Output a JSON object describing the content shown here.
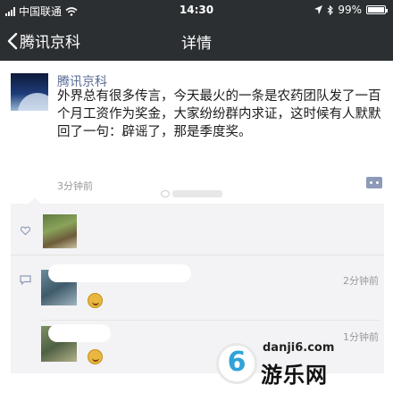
{
  "status_bar": {
    "carrier": "中国联通",
    "time": "14:30",
    "battery": "99%",
    "battery_level": 0.99
  },
  "nav": {
    "back_label": "腾讯京科",
    "title": "详情"
  },
  "post": {
    "author": "腾讯京科",
    "content": "外界总有很多传言，今天最火的一条是农药团队发了一百个月工资作为奖金，大家纷纷群内求证，这时候有人默默回了一句：辟谣了，那是季度奖。",
    "time": "3分钟前"
  },
  "comments": [
    {
      "time": "2分钟前"
    },
    {
      "time": "1分钟前"
    }
  ],
  "watermark": {
    "logo_char": "6",
    "url": "danji6.com",
    "name": "游乐网"
  },
  "colors": {
    "nav_bg": "#2b2f32",
    "author_link": "#586b95",
    "interaction_bg": "#f3f3f5"
  }
}
